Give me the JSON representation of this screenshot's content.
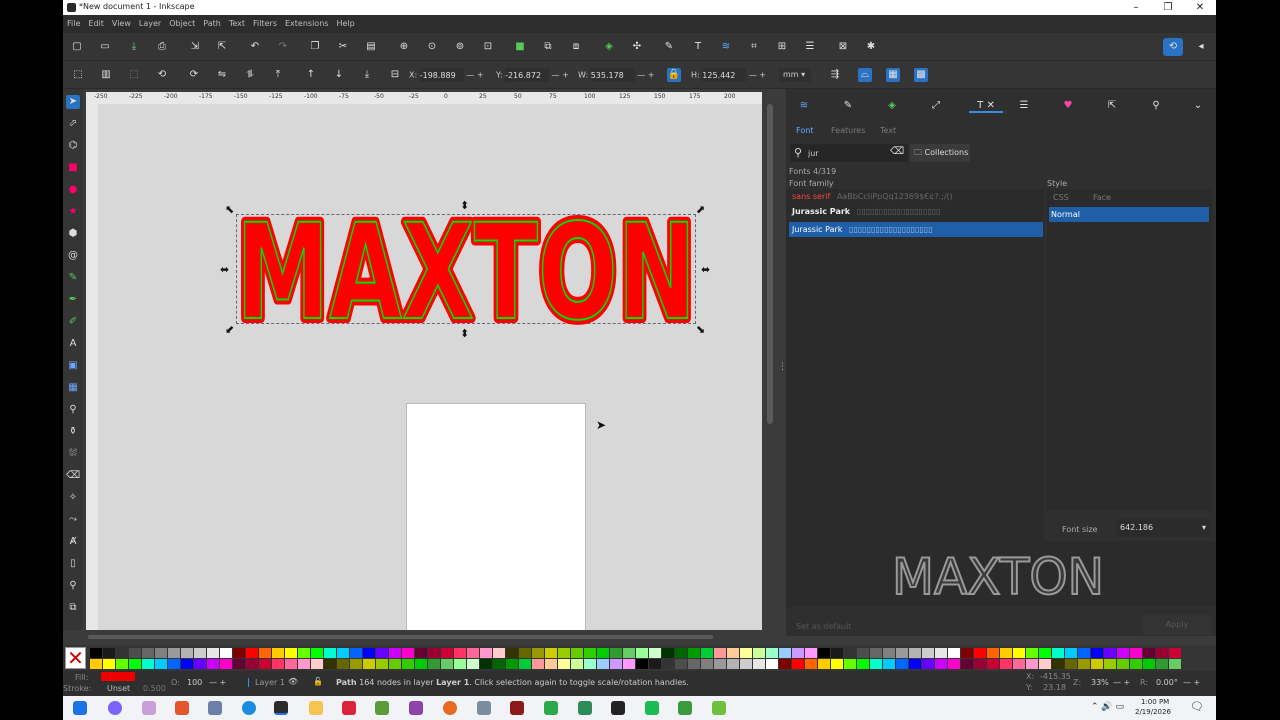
{
  "window": {
    "title": "*New document 1 - Inkscape",
    "minimize": "–",
    "restore": "❐",
    "close": "✕"
  },
  "menu": [
    "File",
    "Edit",
    "View",
    "Layer",
    "Object",
    "Path",
    "Text",
    "Filters",
    "Extensions",
    "Help"
  ],
  "toolbar2": {
    "x_label": "X:",
    "x_value": "-198.889",
    "y_label": "Y:",
    "y_value": "-216.872",
    "w_label": "W:",
    "w_value": "535.178",
    "h_label": "H:",
    "h_value": "125.442",
    "unit": "mm"
  },
  "ruler_h_ticks": [
    "-250",
    "-225",
    "-200",
    "-175",
    "-150",
    "-125",
    "-100",
    "-75",
    "-50",
    "-25",
    "0",
    "25",
    "50",
    "75",
    "100",
    "125",
    "150",
    "175",
    "200"
  ],
  "canvas": {
    "text": "MAXTON",
    "fill": "#ff0000",
    "stroke": "#00e000"
  },
  "panel": {
    "subtabs": [
      "Font",
      "Features",
      "Text"
    ],
    "search_value": "jur",
    "collections_label": "Collections",
    "font_count": "Fonts 4/319",
    "font_family_label": "Font family",
    "style_label": "Style",
    "style_headers": [
      "CSS",
      "Face"
    ],
    "fonts": [
      {
        "name": "sans serif",
        "sample": "AaBbCcIiPpQq12369$€¢?.;/()"
      },
      {
        "name": "Jurassic Park",
        "sample": ""
      },
      {
        "name": "Jurassic Park",
        "sample": ""
      }
    ],
    "style_selected": "Normal",
    "font_size_label": "Font size",
    "font_size_value": "642.186",
    "preview_text": "MAXTON",
    "set_default_label": "Set as default",
    "apply_label": "Apply"
  },
  "status": {
    "fill_label": "Fill:",
    "stroke_label": "Stroke:",
    "stroke_value": "Unset",
    "stroke_width": "0.500",
    "opacity_label": "O:",
    "opacity_value": "100",
    "layer": "Layer 1",
    "message_pre": "Path",
    "message_nodes": "164 nodes in layer",
    "message_layer": "Layer 1",
    "message_post": ". Click selection again to toggle scale/rotation handles.",
    "cursor_x_label": "X:",
    "cursor_x": "-415.35",
    "cursor_y_label": "Y:",
    "cursor_y": "23.18",
    "zoom_label": "Z:",
    "zoom": "33%",
    "rotate_label": "R:",
    "rotate": "0.00°"
  },
  "taskbar": {
    "time": "1:00 PM",
    "date": "2/19/2026"
  }
}
